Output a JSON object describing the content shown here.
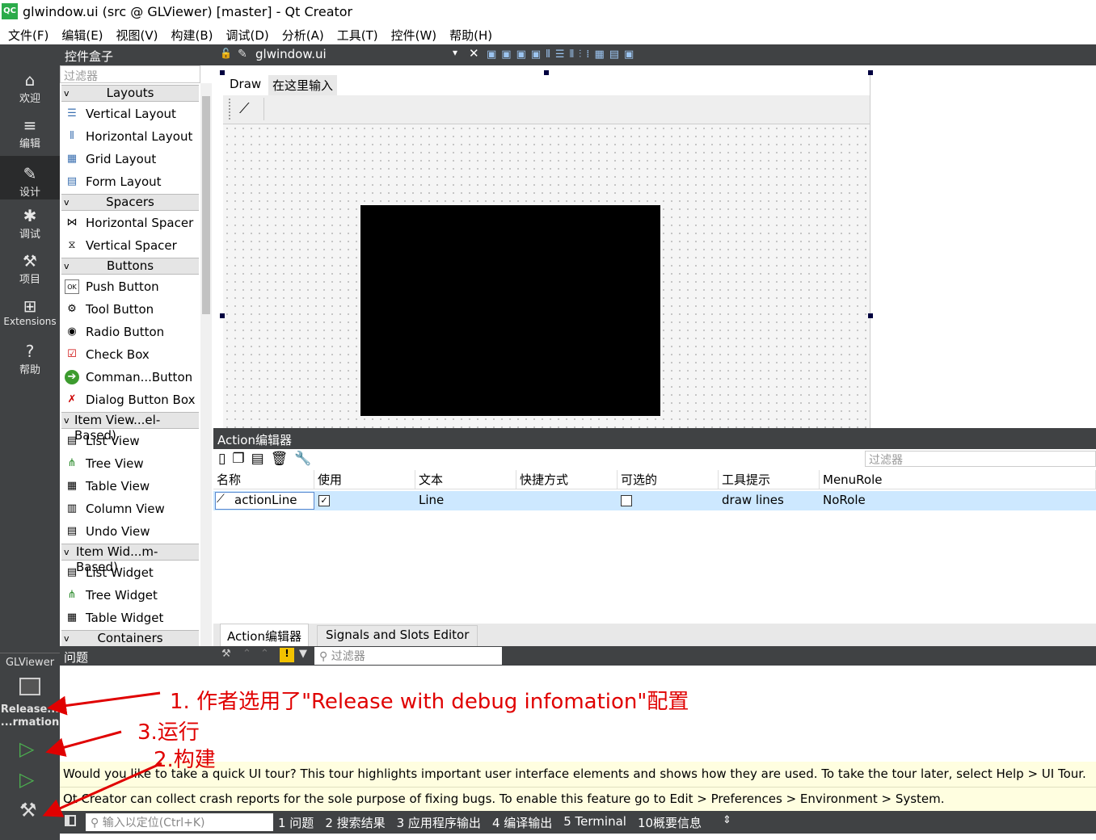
{
  "window": {
    "title": "glwindow.ui (src @ GLViewer) [master] - Qt Creator",
    "app_icon": "QC"
  },
  "menu": [
    "文件(F)",
    "编辑(E)",
    "视图(V)",
    "构建(B)",
    "调试(D)",
    "分析(A)",
    "工具(T)",
    "控件(W)",
    "帮助(H)"
  ],
  "modes": [
    {
      "label": "欢迎",
      "icon": "home-icon",
      "glyph": "⌂"
    },
    {
      "label": "编辑",
      "icon": "edit-icon",
      "glyph": "≡"
    },
    {
      "label": "设计",
      "icon": "design-icon",
      "glyph": "✎"
    },
    {
      "label": "调试",
      "icon": "bug-icon",
      "glyph": "✱"
    },
    {
      "label": "项目",
      "icon": "wrench-icon",
      "glyph": "⚒"
    },
    {
      "label": "Extensions",
      "icon": "extensions-icon",
      "glyph": "⊞"
    },
    {
      "label": "帮助",
      "icon": "help-icon",
      "glyph": "?"
    }
  ],
  "kit": {
    "project": "GLViewer",
    "build_line1": "Release...",
    "build_line2": "...rmation"
  },
  "widget_box": {
    "title": "控件盒子",
    "filter_placeholder": "过滤器",
    "categories": {
      "layouts": "Layouts",
      "spacers": "Spacers",
      "buttons": "Buttons",
      "item_views": "Item View...el-Based)",
      "item_widgets": "Item Wid...m-Based)",
      "containers": "Containers"
    },
    "items": {
      "vertical_layout": "Vertical Layout",
      "horizontal_layout": "Horizontal Layout",
      "grid_layout": "Grid Layout",
      "form_layout": "Form Layout",
      "horizontal_spacer": "Horizontal Spacer",
      "vertical_spacer": "Vertical Spacer",
      "push_button": "Push Button",
      "tool_button": "Tool Button",
      "radio_button": "Radio Button",
      "check_box": "Check Box",
      "command_button": "Comman...Button",
      "dialog_button_box": "Dialog Button Box",
      "list_view": "List View",
      "tree_view": "Tree View",
      "table_view": "Table View",
      "column_view": "Column View",
      "undo_view": "Undo View",
      "list_widget": "List Widget",
      "tree_widget": "Tree Widget",
      "table_widget": "Table Widget"
    }
  },
  "form": {
    "file_name": "glwindow.ui",
    "menu_items": [
      "Draw",
      "在这里输入"
    ]
  },
  "action_editor": {
    "title": "Action编辑器",
    "filter_placeholder": "过滤器",
    "columns": [
      "名称",
      "使用",
      "文本",
      "快捷方式",
      "可选的",
      "工具提示",
      "MenuRole"
    ],
    "row": {
      "name": "actionLine",
      "used": true,
      "text": "Line",
      "shortcut": "",
      "checkable": false,
      "tooltip": "draw lines",
      "menu_role": "NoRole"
    },
    "tabs": [
      "Action编辑器",
      "Signals and Slots Editor"
    ]
  },
  "issues": {
    "title": "问题",
    "filter_placeholder": "过滤器"
  },
  "info": {
    "tour": "Would you like to take a quick UI tour? This tour highlights important user interface elements and shows how they are used. To take the tour later, select Help > UI Tour.",
    "crash": "Qt Creator can collect crash reports for the sole purpose of fixing bugs. To enable this feature go to Edit > Preferences > Environment > System."
  },
  "status": {
    "locator_placeholder": "输入以定位(Ctrl+K)",
    "panes": [
      "1 问题",
      "2 搜索结果",
      "3 应用程序输出",
      "4 编译输出",
      "5 Terminal",
      "10概要信息"
    ]
  },
  "annotations": {
    "a1": "1. 作者选用了\"Release with debug infomation\"配置",
    "a3": "3.运行",
    "a2": "2.构建",
    "color": "#e00000"
  }
}
